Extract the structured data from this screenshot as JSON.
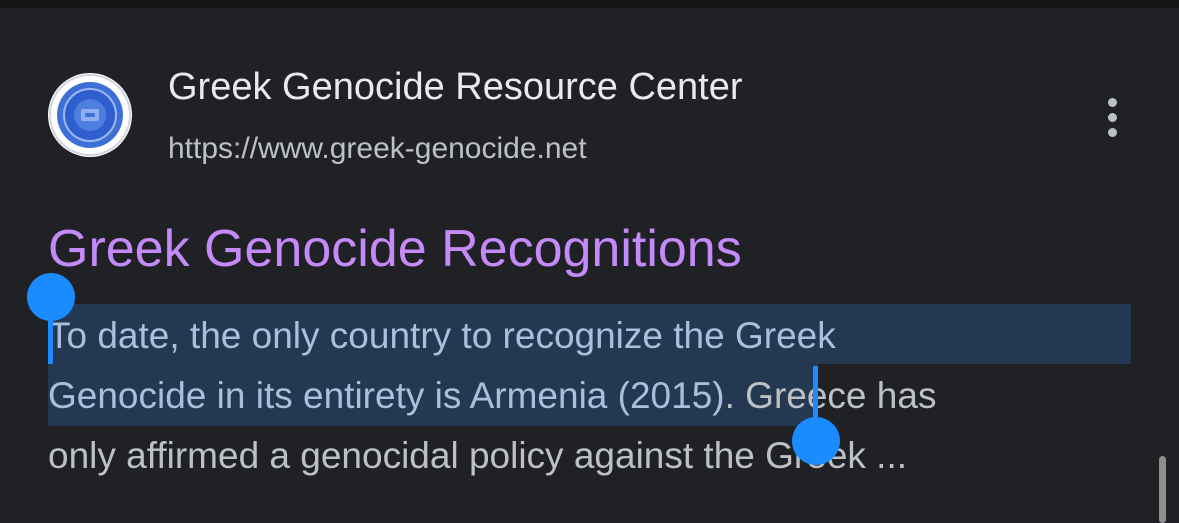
{
  "result": {
    "site_name": "Greek Genocide Resource Center",
    "site_url": "https://www.greek-genocide.net",
    "title": "Greek Genocide Recognitions",
    "snippet": {
      "line1_selected": "To date, the only country to recognize the Greek",
      "line2_selected": "Genocide in its entirety is Armenia (2015)",
      "line2_rest": ". Greece has",
      "line3": "only affirmed a genocidal policy against the Greek ..."
    },
    "favicon": "greek-genocide-site-logo",
    "more_icon": "more-vert-icon"
  },
  "colors": {
    "background": "#202124",
    "title_visited": "#c58af9",
    "selection_highlight": "#243851",
    "selection_handle": "#1a8cff"
  }
}
